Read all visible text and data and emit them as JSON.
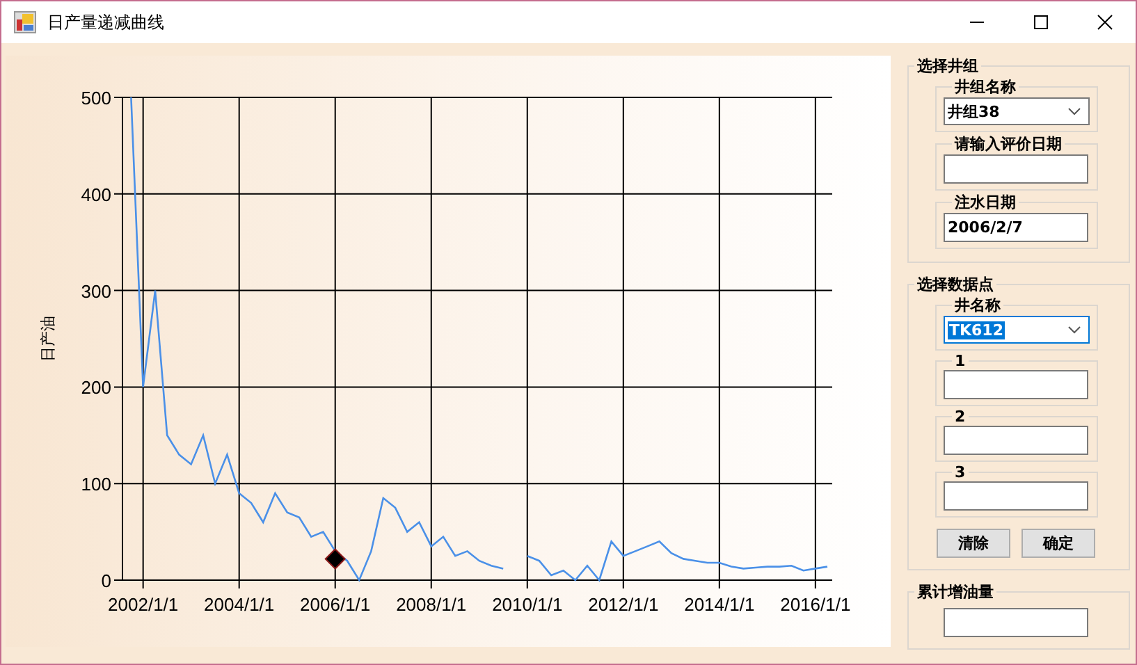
{
  "window": {
    "title": "日产量递减曲线"
  },
  "chart": {
    "chart_data": {
      "type": "line",
      "ylabel": "日产油",
      "ylim": [
        0,
        500
      ],
      "grid": true,
      "yticks": [
        0,
        100,
        200,
        300,
        400,
        500
      ],
      "categories": [
        null,
        "2002/1/1",
        null,
        null,
        null,
        null,
        null,
        null,
        null,
        "2004/1/1",
        null,
        null,
        null,
        null,
        null,
        null,
        null,
        "2006/1/1",
        null,
        null,
        null,
        null,
        null,
        null,
        null,
        "2008/1/1",
        null,
        null,
        null,
        null,
        null,
        null,
        null,
        "2010/1/1",
        null,
        null,
        null,
        null,
        null,
        null,
        null,
        "2012/1/1",
        null,
        null,
        null,
        null,
        null,
        null,
        null,
        "2014/1/1",
        null,
        null,
        null,
        null,
        null,
        null,
        null,
        "2016/1/1",
        null
      ],
      "series": [
        {
          "color": "#4a90e8",
          "values": [
            500,
            200,
            300,
            150,
            130,
            120,
            150,
            100,
            130,
            90,
            80,
            60,
            90,
            70,
            65,
            45,
            50,
            30,
            20,
            0,
            30,
            85,
            75,
            50,
            60,
            35,
            45,
            25,
            30,
            20,
            15,
            12,
            null,
            25,
            20,
            5,
            10,
            0,
            15,
            0,
            40,
            25,
            30,
            35,
            40,
            28,
            22,
            20,
            18,
            18,
            14,
            12,
            13,
            14,
            14,
            15,
            10,
            12,
            14
          ]
        },
        {
          "color": "#000000",
          "marker": "diamond",
          "values": [
            null,
            null,
            null,
            null,
            null,
            null,
            null,
            null,
            null,
            null,
            null,
            null,
            null,
            null,
            null,
            null,
            null,
            22,
            null,
            null,
            null,
            null,
            null,
            null,
            null,
            null,
            null,
            null,
            null,
            null,
            null,
            null,
            null,
            null,
            null,
            null,
            null,
            null,
            null,
            null,
            null,
            null,
            null,
            null,
            null,
            null,
            null,
            null,
            null,
            null,
            null,
            null,
            null,
            null,
            null,
            null,
            null,
            null,
            null
          ]
        }
      ]
    }
  },
  "groups": [
    {
      "title": "选择井组",
      "fields": [
        {
          "kind": "combo",
          "label": "井组名称",
          "value": "井组38"
        },
        {
          "kind": "text",
          "label": "请输入评价日期"
        },
        {
          "kind": "text",
          "label": "注水日期",
          "value": "2006/2/7"
        }
      ]
    },
    {
      "title": "选择数据点",
      "fields": [
        {
          "kind": "combo",
          "label": "井名称",
          "value": "TK612",
          "highlighted": true
        },
        {
          "kind": "text",
          "label": "1"
        },
        {
          "kind": "text",
          "label": "2"
        },
        {
          "kind": "text",
          "label": "3"
        }
      ],
      "buttons": [
        "清除",
        "确定"
      ]
    },
    {
      "title": "累计增油量",
      "fields": [
        {
          "kind": "bare"
        }
      ]
    }
  ]
}
